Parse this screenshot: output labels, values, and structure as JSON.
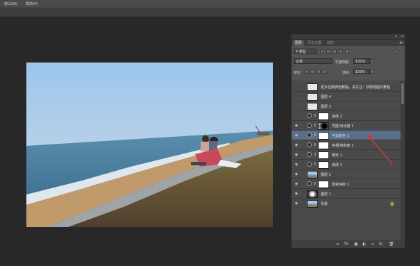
{
  "menu": {
    "items": [
      "窗口(W)",
      "帮助(H)"
    ]
  },
  "panel": {
    "tabs": [
      "图层",
      "历史记录",
      "动作"
    ],
    "filter_value": "P 类型",
    "blend_mode": "正常",
    "opacity_label": "不透明度:",
    "opacity_value": "100%",
    "lock_label": "锁定:",
    "fill_label": "填充:",
    "fill_value": "100%"
  },
  "layers": [
    {
      "name": "更多后期调色教程，请关注：涂鸦吧图文教程",
      "thumb": "check",
      "eye": false,
      "adj": false,
      "selected": false
    },
    {
      "name": "图层 4",
      "thumb": "check",
      "eye": false,
      "adj": false,
      "selected": false
    },
    {
      "name": "图层 3",
      "thumb": "check",
      "eye": false,
      "adj": false,
      "selected": false
    },
    {
      "name": "曲线 2",
      "thumb": "white",
      "eye": false,
      "adj": true,
      "selected": false
    },
    {
      "name": "亮度/对比度 1",
      "thumb": "dark",
      "eye": true,
      "adj": true,
      "selected": false
    },
    {
      "name": "可选颜色 1",
      "thumb": "white",
      "eye": true,
      "adj": true,
      "selected": true
    },
    {
      "name": "色相/饱和度 1",
      "thumb": "white",
      "eye": true,
      "adj": true,
      "selected": false
    },
    {
      "name": "曝光 1",
      "thumb": "white",
      "eye": true,
      "adj": true,
      "selected": false
    },
    {
      "name": "曲线 1",
      "thumb": "white",
      "eye": true,
      "adj": true,
      "selected": false
    },
    {
      "name": "图层 2",
      "thumb": "photo",
      "eye": true,
      "adj": false,
      "selected": false
    },
    {
      "name": "渐变映射 1",
      "thumb": "white",
      "eye": true,
      "adj": true,
      "selected": false
    },
    {
      "name": "图层 1",
      "thumb": "mask2",
      "eye": true,
      "adj": false,
      "selected": false
    },
    {
      "name": "背景",
      "thumb": "photo",
      "eye": true,
      "adj": false,
      "selected": false,
      "locked": true
    }
  ],
  "bottom_icons": [
    "link-icon",
    "fx-icon",
    "mask-icon",
    "adjustment-icon",
    "folder-icon",
    "new-layer-icon",
    "trash-icon"
  ],
  "colors": {
    "selected_row": "#5a6f8a",
    "panel_bg": "#535353"
  }
}
